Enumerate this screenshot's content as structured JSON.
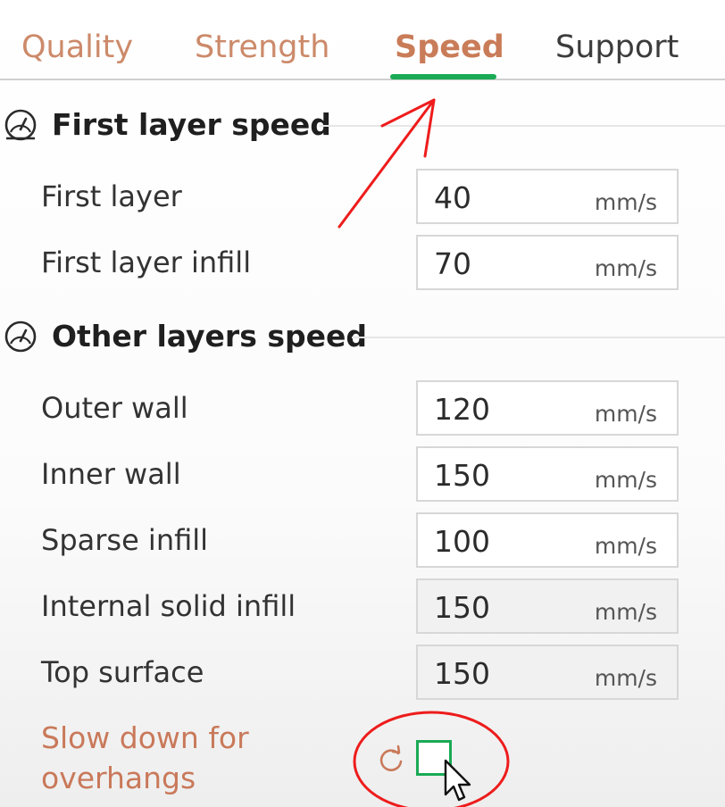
{
  "tabs": [
    {
      "label": "Quality"
    },
    {
      "label": "Strength"
    },
    {
      "label": "Speed"
    },
    {
      "label": "Support"
    }
  ],
  "active_tab": "Speed",
  "sections": [
    {
      "title": "First layer speed",
      "icon": "gauge-icon",
      "rows": [
        {
          "label": "First layer",
          "value": "40",
          "unit": "mm/s"
        },
        {
          "label": "First layer infill",
          "value": "70",
          "unit": "mm/s"
        }
      ]
    },
    {
      "title": "Other layers speed",
      "icon": "gauge-icon",
      "rows": [
        {
          "label": "Outer wall",
          "value": "120",
          "unit": "mm/s"
        },
        {
          "label": "Inner wall",
          "value": "150",
          "unit": "mm/s"
        },
        {
          "label": "Sparse infill",
          "value": "100",
          "unit": "mm/s"
        },
        {
          "label": "Internal solid infill",
          "value": "150",
          "unit": "mm/s"
        },
        {
          "label": "Top surface",
          "value": "150",
          "unit": "mm/s"
        }
      ]
    }
  ],
  "slow_down": {
    "label_line1": "Slow down for",
    "label_line2": "overhangs",
    "checked": false,
    "reset_icon": "reset-icon"
  },
  "colors": {
    "accent_green": "#1aaa55",
    "modified_label": "#c9795a",
    "annotation_red": "#ee1c1c"
  }
}
